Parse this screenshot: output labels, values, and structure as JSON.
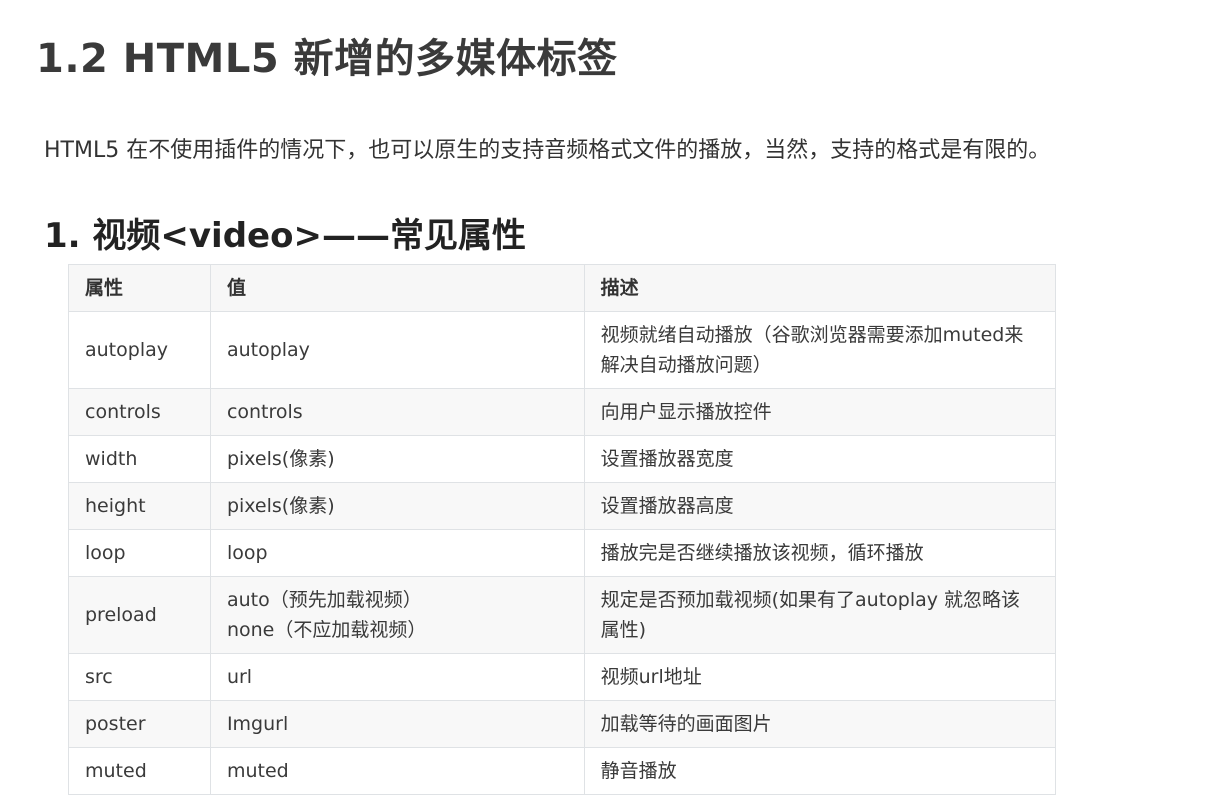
{
  "title": "1.2 HTML5 新增的多媒体标签",
  "intro": "HTML5 在不使用插件的情况下，也可以原生的支持音频格式文件的播放，当然，支持的格式是有限的。",
  "section_title": "1. 视频<video>——常见属性",
  "table": {
    "headers": [
      "属性",
      "值",
      "描述"
    ],
    "rows": [
      {
        "attr": "autoplay",
        "values": [
          "autoplay"
        ],
        "desc": "视频就绪自动播放（谷歌浏览器需要添加muted来解决自动播放问题）"
      },
      {
        "attr": "controls",
        "values": [
          "controls"
        ],
        "desc": "向用户显示播放控件"
      },
      {
        "attr": "width",
        "values": [
          "pixels(像素)"
        ],
        "desc": "设置播放器宽度"
      },
      {
        "attr": "height",
        "values": [
          "pixels(像素)"
        ],
        "desc": "设置播放器高度"
      },
      {
        "attr": "loop",
        "values": [
          "loop"
        ],
        "desc": "播放完是否继续播放该视频，循环播放"
      },
      {
        "attr": "preload",
        "values": [
          "auto（预先加载视频）",
          "none（不应加载视频）"
        ],
        "desc": "规定是否预加载视频(如果有了autoplay 就忽略该属性)"
      },
      {
        "attr": "src",
        "values": [
          "url"
        ],
        "desc": "视频url地址"
      },
      {
        "attr": "poster",
        "values": [
          "Imgurl"
        ],
        "desc": "加载等待的画面图片"
      },
      {
        "attr": "muted",
        "values": [
          "muted"
        ],
        "desc": "静音播放"
      }
    ]
  }
}
